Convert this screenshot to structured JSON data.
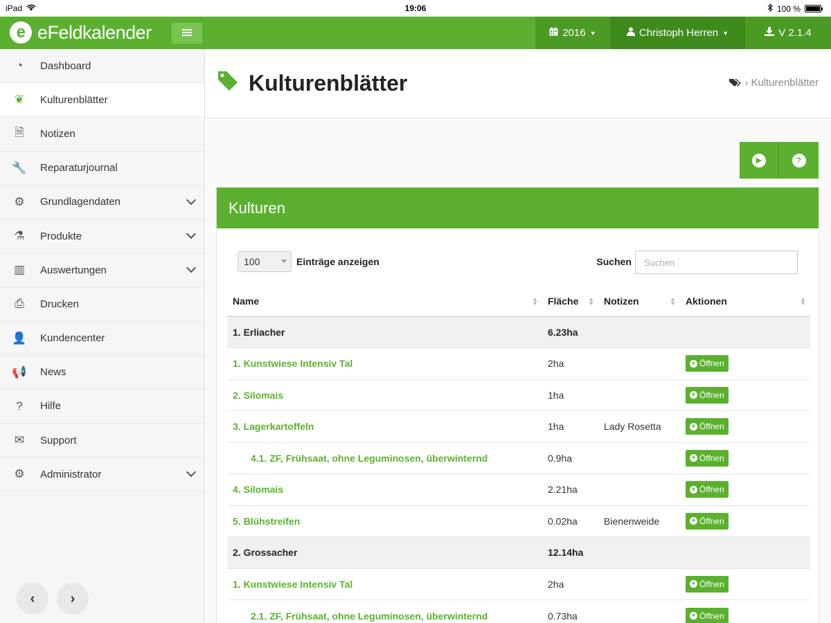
{
  "status_bar": {
    "device": "iPad",
    "time": "19:06",
    "battery": "100 %",
    "battery_level": 1.0
  },
  "topnav": {
    "brand": "eFeldkalender",
    "brand_mark": "e",
    "year": "2016",
    "user": "Christoph Herren",
    "version": "V 2.1.4",
    "accent_color": "#5bb12f"
  },
  "sidebar": {
    "items": [
      {
        "label": "Dashboard",
        "icon": "dashboard-icon",
        "glyph": "◔",
        "expandable": false,
        "active": false
      },
      {
        "label": "Kulturenblätter",
        "icon": "leaf-icon",
        "glyph": "❦",
        "expandable": false,
        "active": true
      },
      {
        "label": "Notizen",
        "icon": "file-icon",
        "glyph": "🗎",
        "expandable": false,
        "active": false
      },
      {
        "label": "Reparaturjournal",
        "icon": "wrench-icon",
        "glyph": "🔧",
        "expandable": false,
        "active": false
      },
      {
        "label": "Grundlagendaten",
        "icon": "gears-icon",
        "glyph": "⚙",
        "expandable": true,
        "active": false
      },
      {
        "label": "Produkte",
        "icon": "flask-icon",
        "glyph": "⚗",
        "expandable": true,
        "active": false
      },
      {
        "label": "Auswertungen",
        "icon": "bar-chart-icon",
        "glyph": "▥",
        "expandable": true,
        "active": false
      },
      {
        "label": "Drucken",
        "icon": "print-icon",
        "glyph": "⎙",
        "expandable": false,
        "active": false
      },
      {
        "label": "Kundencenter",
        "icon": "user-icon",
        "glyph": "👤",
        "expandable": false,
        "active": false
      },
      {
        "label": "News",
        "icon": "megaphone-icon",
        "glyph": "📢",
        "expandable": false,
        "active": false
      },
      {
        "label": "Hilfe",
        "icon": "question-icon",
        "glyph": "?",
        "expandable": false,
        "active": false
      },
      {
        "label": "Support",
        "icon": "envelope-icon",
        "glyph": "✉",
        "expandable": false,
        "active": false
      },
      {
        "label": "Administrator",
        "icon": "gear-icon",
        "glyph": "⚙",
        "expandable": true,
        "active": false
      }
    ],
    "back_glyph": "‹",
    "forward_glyph": "›"
  },
  "page": {
    "title": "Kulturenblätter",
    "breadcrumb_current": "Kulturenblätter"
  },
  "panel": {
    "title": "Kulturen",
    "page_length": "100",
    "length_label": "Einträge anzeigen",
    "search_label": "Suchen",
    "search_placeholder": "Suchen",
    "columns": [
      "Name",
      "Fläche",
      "Notizen",
      "Aktionen"
    ],
    "open_label": "Öffnen",
    "rows": [
      {
        "type": "group",
        "name": "1. Erliacher",
        "area": "6.23ha",
        "note": ""
      },
      {
        "type": "item",
        "name": "1. Kunstwiese Intensiv Tal",
        "area": "2ha",
        "note": "",
        "sub": false
      },
      {
        "type": "item",
        "name": "2. Silomais",
        "area": "1ha",
        "note": "",
        "sub": false
      },
      {
        "type": "item",
        "name": "3. Lagerkartoffeln",
        "area": "1ha",
        "note": "Lady Rosetta",
        "sub": false
      },
      {
        "type": "item",
        "name": "4.1. ZF, Frühsaat, ohne Leguminosen, überwinternd",
        "area": "0.9ha",
        "note": "",
        "sub": true
      },
      {
        "type": "item",
        "name": "4. Silomais",
        "area": "2.21ha",
        "note": "",
        "sub": false
      },
      {
        "type": "item",
        "name": "5. Blühstreifen",
        "area": "0.02ha",
        "note": "Bienenweide",
        "sub": false
      },
      {
        "type": "group",
        "name": "2. Grossacher",
        "area": "12.14ha",
        "note": ""
      },
      {
        "type": "item",
        "name": "1. Kunstwiese Intensiv Tal",
        "area": "2ha",
        "note": "",
        "sub": false
      },
      {
        "type": "item",
        "name": "2.1. ZF, Frühsaat, ohne Leguminosen, überwinternd",
        "area": "0.73ha",
        "note": "",
        "sub": true
      }
    ]
  }
}
